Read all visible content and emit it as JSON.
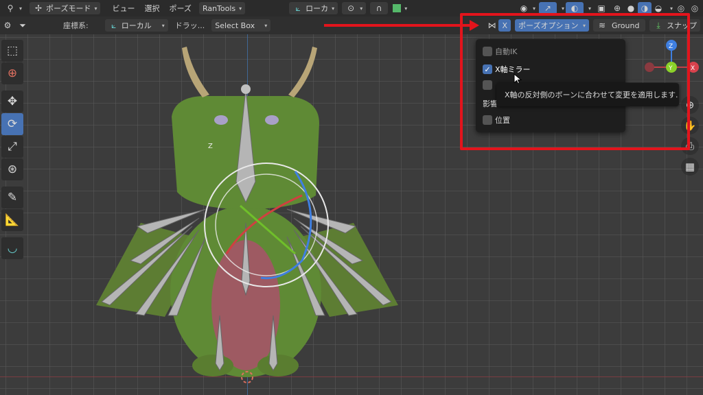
{
  "header_top": {
    "mode_label": "ポーズモード",
    "menus": [
      "ビュー",
      "選択",
      "ポーズ"
    ],
    "addon_label": "RanTools",
    "transform_label": "ローカ"
  },
  "header_second": {
    "coord_label": "座標系:",
    "coord_value": "ローカル",
    "drag_label": "ドラッ...",
    "drag_value": "Select Box",
    "x_button": "X",
    "pose_options": "ポーズオプション",
    "ground_label": "Ground",
    "snap_label": "スナップ"
  },
  "pose_options_menu": {
    "items": [
      {
        "label": "自動IK",
        "checked": false
      },
      {
        "label": "X軸ミラー",
        "checked": true
      },
      {
        "label": "",
        "checked": false
      },
      {
        "label": "影響",
        "checked": false
      },
      {
        "label": "位置",
        "checked": false
      }
    ],
    "tooltip": "X軸の反対側のボーンに合わせて変更を適用します."
  },
  "gizmo": {
    "z": "Z",
    "y": "Y",
    "x": "X"
  },
  "viewport": {
    "bone_axis_label": "Z"
  },
  "colors": {
    "accent": "#4772b3",
    "highlight": "#e3141c"
  }
}
